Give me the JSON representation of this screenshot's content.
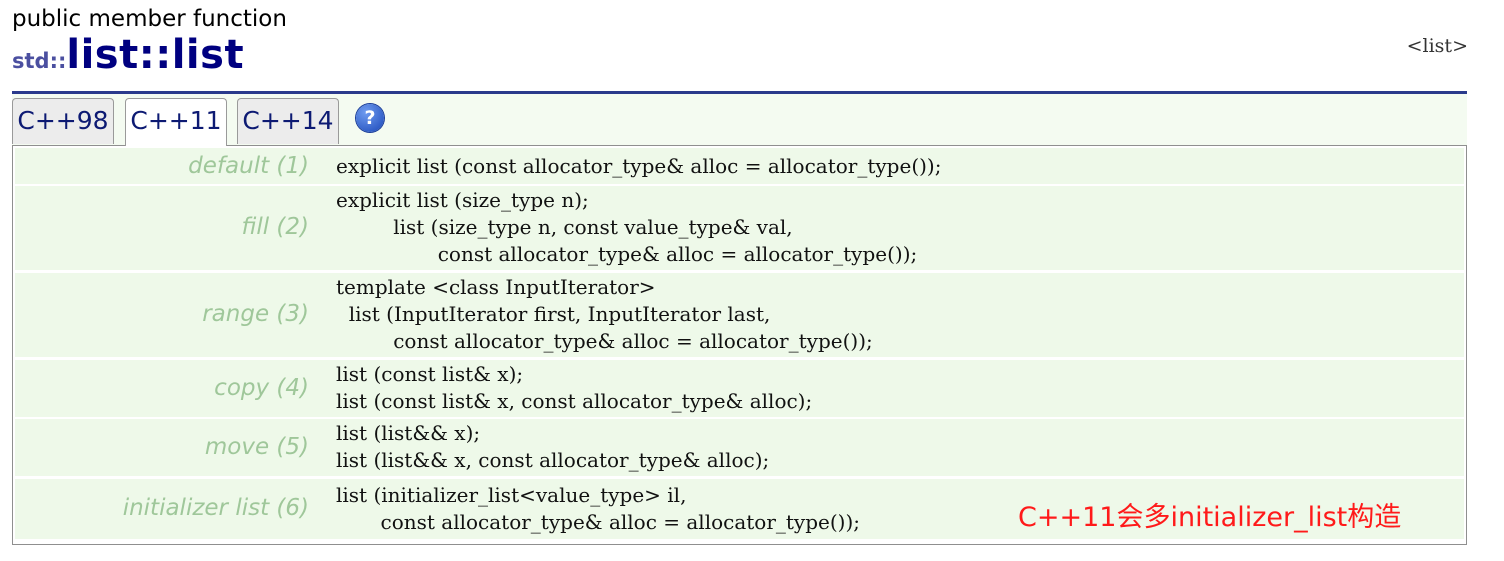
{
  "header": {
    "kind": "public member function",
    "namespace": "std::",
    "function_name": "list::list",
    "header_link": "<list>"
  },
  "tabs": [
    {
      "label": "C++98",
      "active": false
    },
    {
      "label": "C++11",
      "active": true
    },
    {
      "label": "C++14",
      "active": false
    }
  ],
  "help_icon": {
    "symbol": "?",
    "name": "help-icon"
  },
  "signatures": [
    {
      "label": "default (1)",
      "code": "explicit list (const allocator_type& alloc = allocator_type());"
    },
    {
      "label": "fill (2)",
      "code": "explicit list (size_type n);\n         list (size_type n, const value_type& val,\n                const allocator_type& alloc = allocator_type());"
    },
    {
      "label": "range (3)",
      "code": "template <class InputIterator>\n  list (InputIterator first, InputIterator last,\n         const allocator_type& alloc = allocator_type());"
    },
    {
      "label": "copy (4)",
      "code": "list (const list& x);\nlist (const list& x, const allocator_type& alloc);"
    },
    {
      "label": "move (5)",
      "code": "list (list&& x);\nlist (list&& x, const allocator_type& alloc);"
    },
    {
      "label": "initializer list (6)",
      "code": "list (initializer_list<value_type> il,\n       const allocator_type& alloc = allocator_type());"
    }
  ],
  "annotation": "C++11会多initializer_list构造",
  "colors": {
    "title": "#000080",
    "namespace": "#4b4fa0",
    "rule": "#2a3a8c",
    "row_background": "#eef9e9",
    "row_label": "#9fc79a",
    "annotation": "#ff1a1a"
  }
}
